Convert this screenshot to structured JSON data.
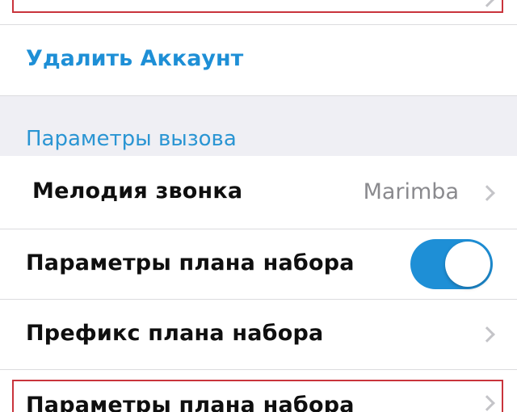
{
  "account": {
    "delete_label": "Удалить Аккаунт"
  },
  "call_settings": {
    "section_title": "Параметры вызова",
    "ringtone": {
      "label": "Мелодия звонка",
      "value": "Marimba"
    },
    "dial_plan_settings": {
      "label": "Параметры плана набора",
      "enabled": true
    },
    "dial_plan_prefix": {
      "label": "Префикс плана набора"
    },
    "dial_plan_settings_detail": {
      "label": "Параметры плана набора"
    }
  },
  "colors": {
    "accent": "#1e8fd6",
    "highlight_border": "#c9343c",
    "section_background": "#efeff4"
  }
}
